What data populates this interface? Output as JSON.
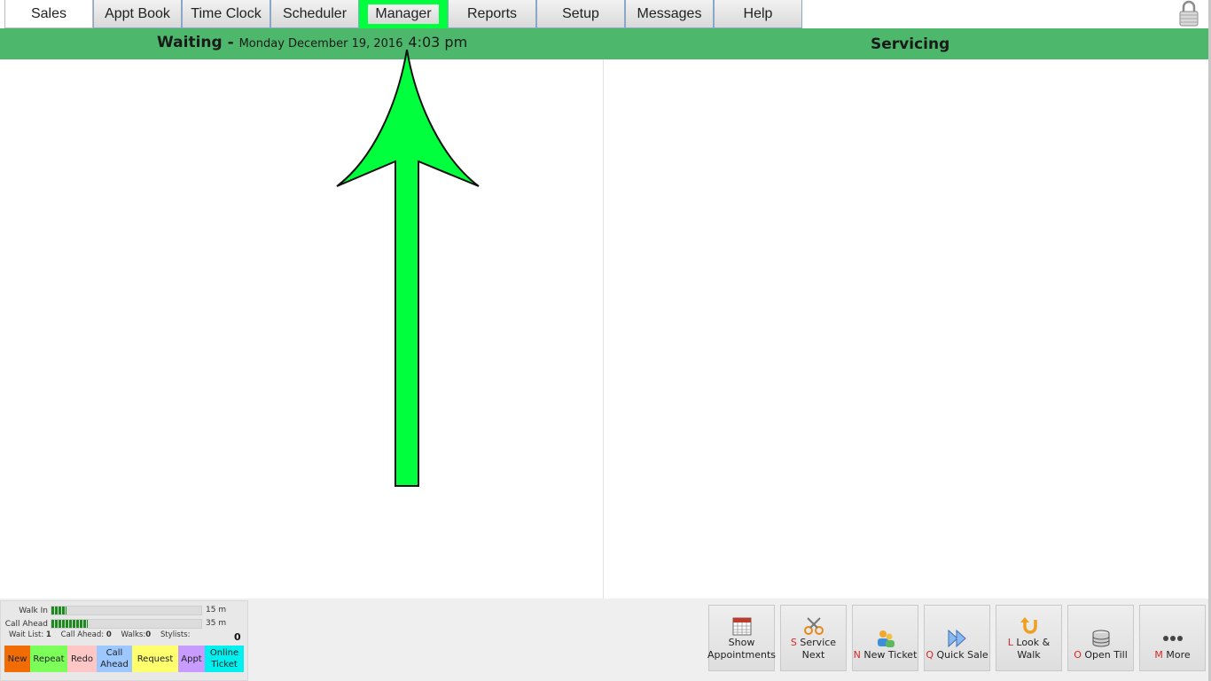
{
  "tabs": [
    {
      "label": "Sales"
    },
    {
      "label": "Appt Book"
    },
    {
      "label": "Time Clock"
    },
    {
      "label": "Scheduler"
    },
    {
      "label": "Manager"
    },
    {
      "label": "Reports"
    },
    {
      "label": "Setup"
    },
    {
      "label": "Messages"
    },
    {
      "label": "Help"
    }
  ],
  "header": {
    "waiting_title": "Waiting -",
    "date": "Monday December 19, 2016",
    "time": "4:03 pm",
    "servicing_title": "Servicing"
  },
  "stats": {
    "walk_in_label": "Walk In",
    "walk_in_minutes": "15 m",
    "walk_in_level": 0.1,
    "call_ahead_label": "Call Ahead",
    "call_ahead_minutes": "35 m",
    "call_ahead_level": 0.24,
    "wait_list_label": "Wait List:",
    "wait_list_value": "1",
    "call_ahead_count_label": "Call Ahead:",
    "call_ahead_count_value": "0",
    "walks_label": "Walks:",
    "walks_value": "0",
    "stylists_label": "Stylists:",
    "stylists_value": "0"
  },
  "legend": [
    {
      "label": "New",
      "color": "#f26c05"
    },
    {
      "label": "Repeat",
      "color": "#7dff5a"
    },
    {
      "label": "Redo",
      "color": "#ffc6c6"
    },
    {
      "label": "Call Ahead",
      "color": "#9dc8ff"
    },
    {
      "label": "Request",
      "color": "#ffff6e"
    },
    {
      "label": "Appt",
      "color": "#c79bff"
    },
    {
      "label": "Online Ticket",
      "color": "#00f0f0"
    }
  ],
  "actions": [
    {
      "key": "",
      "label": "Show Appointments",
      "icon": "calendar-icon"
    },
    {
      "key": "S",
      "label": "Service Next",
      "icon": "scissors-icon"
    },
    {
      "key": "N",
      "label": "New Ticket",
      "icon": "people-icon"
    },
    {
      "key": "Q",
      "label": "Quick Sale",
      "icon": "fast-forward-icon"
    },
    {
      "key": "L",
      "label": "Look & Walk",
      "icon": "u-turn-icon"
    },
    {
      "key": "O",
      "label": "Open Till",
      "icon": "coin-stack-icon"
    },
    {
      "key": "M",
      "label": "More",
      "icon": "ellipsis-icon"
    }
  ],
  "colors": {
    "header_green": "#4db86b",
    "highlight_green": "#00ff3c",
    "hotkey_red": "#d62a2a"
  }
}
